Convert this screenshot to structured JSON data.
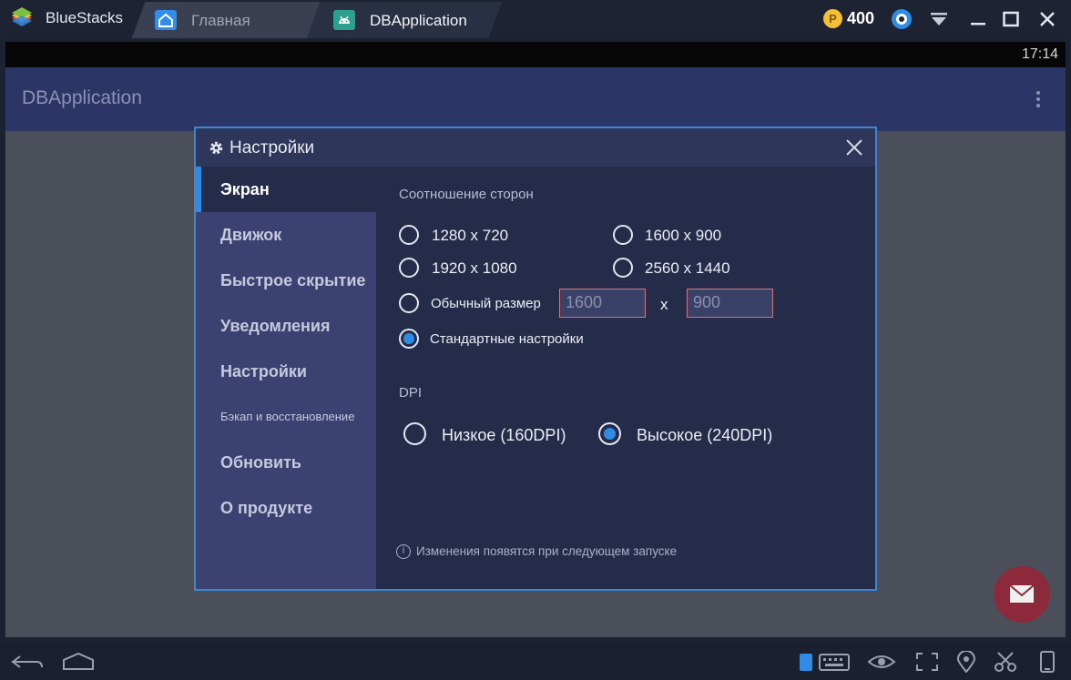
{
  "app": {
    "name": "BlueStacks"
  },
  "tabs": [
    {
      "label": "Главная",
      "icon": "home-icon"
    },
    {
      "label": "DBApplication",
      "icon": "android-icon"
    }
  ],
  "topbar": {
    "coins": "400",
    "coin_symbol": "P"
  },
  "status": {
    "time": "17:14"
  },
  "app_screen": {
    "title": "DBApplication"
  },
  "dialog": {
    "title": "Настройки",
    "sidebar": [
      {
        "label": "Экран",
        "active": true
      },
      {
        "label": "Движок"
      },
      {
        "label": "Быстрое скрытие"
      },
      {
        "label": "Уведомления"
      },
      {
        "label": "Настройки"
      },
      {
        "label": "Бэкап и восстановление"
      },
      {
        "label": "Обновить"
      },
      {
        "label": "О продукте"
      }
    ],
    "resolution": {
      "heading": "Соотношение сторон",
      "options": [
        "1280 x 720",
        "1600 x 900",
        "1920 x 1080",
        "2560 x 1440"
      ],
      "custom_label": "Обычный размер",
      "custom_width": "1600",
      "custom_height": "900",
      "times": "x",
      "default_label": "Стандартные настройки",
      "selected": "Стандартные настройки"
    },
    "dpi": {
      "heading": "DPI",
      "low": "Низкое (160DPI)",
      "high": "Высокое (240DPI)",
      "selected": "Высокое (240DPI)"
    },
    "note": "Изменения появятся при следующем запуске"
  },
  "colors": {
    "accent": "#2f8be4",
    "dialog_bg": "#252c4a",
    "sidebar_bg": "#3b4271",
    "appbar": "#2b3566"
  }
}
